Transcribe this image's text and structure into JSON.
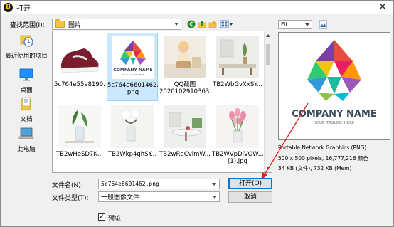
{
  "window": {
    "title": "打开",
    "close_glyph": "✕"
  },
  "lookin": {
    "label": "查找范围(I):",
    "value": "图片"
  },
  "places": [
    {
      "label": "最近使用的项目",
      "icon": "recent-items-icon"
    },
    {
      "label": "桌面",
      "icon": "desktop-icon"
    },
    {
      "label": "文档",
      "icon": "documents-icon"
    },
    {
      "label": "此电脑",
      "icon": "this-pc-icon"
    }
  ],
  "files": [
    {
      "name": "5c764e55a8190...",
      "kind": "shoe"
    },
    {
      "name": "5c764e6601462.",
      "name2": "png",
      "kind": "logo",
      "selected": true
    },
    {
      "name": "QQ截图",
      "name2": "2020102910363...",
      "kind": "child"
    },
    {
      "name": "TB2WbGvXxSY...",
      "kind": "room"
    },
    {
      "name": "TB2wHeSD7K...",
      "kind": "vase"
    },
    {
      "name": "TB2Wkp4qhSY...",
      "kind": "flowers"
    },
    {
      "name": "TB2wRqCvimW...",
      "kind": "table"
    },
    {
      "name": "TB2WVpDiVOW...",
      "name2": "(1).jpg",
      "kind": "tulips"
    }
  ],
  "preview": {
    "zoom": "Fit",
    "logo_title": "COMPANY NAME",
    "logo_tagline": "YOUR TAGLINE HERE",
    "info_line1": "Portable Network Graphics (PNG)",
    "info_line2": "500 x 500 pixels, 16,777,216 颜色",
    "info_line3": "34 KB (文件), 732 KB (Mem)"
  },
  "logo_thumb": {
    "title": "COMPANY NAME",
    "tagline": "YOUR TAGLINE HERE"
  },
  "form": {
    "filename_label": "文件名(N):",
    "filename_value": "5c764e6601462.png",
    "filetype_label": "文件类型(T):",
    "filetype_value": "一般图像文件",
    "open_button": "打开(O)",
    "cancel_button": "取消",
    "preview_label": "预览",
    "preview_checked": "✓"
  },
  "colors": {
    "accent": "#0078d7",
    "selection": "#cce8ff",
    "arrow_annotation": "#e02020"
  }
}
